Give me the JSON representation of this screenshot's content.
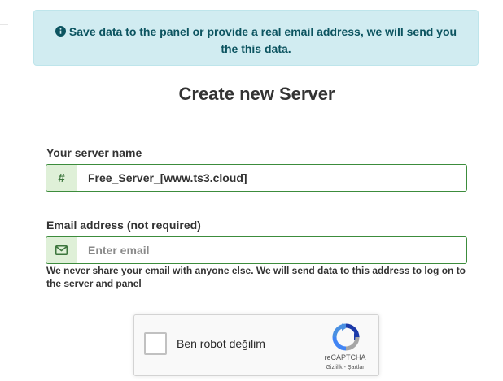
{
  "alert": {
    "icon": "info-circle-icon",
    "message": "Save data to the panel or provide a real email address, we will send you the this data.",
    "color": "#0c5460",
    "background": "#d1ecf1"
  },
  "page": {
    "title": "Create new Server"
  },
  "server_name": {
    "label": "Your server name",
    "addon_symbol": "#",
    "value": "Free_Server_[www.ts3.cloud]"
  },
  "email": {
    "label": "Email address (not required)",
    "addon_icon": "envelope-icon",
    "placeholder": "Enter email",
    "value": "",
    "help_text": "We never share your email with anyone else. We will send data to this address to log on to the server and panel"
  },
  "recaptcha": {
    "checkbox_label": "Ben robot değilim",
    "brand": "reCAPTCHA",
    "privacy_link": "Gizlilik",
    "separator": " - ",
    "terms_link": "Şartlar"
  },
  "colors": {
    "success_border": "#3c8c3c",
    "success_addon_bg": "#dff0d8",
    "text": "#333333"
  }
}
